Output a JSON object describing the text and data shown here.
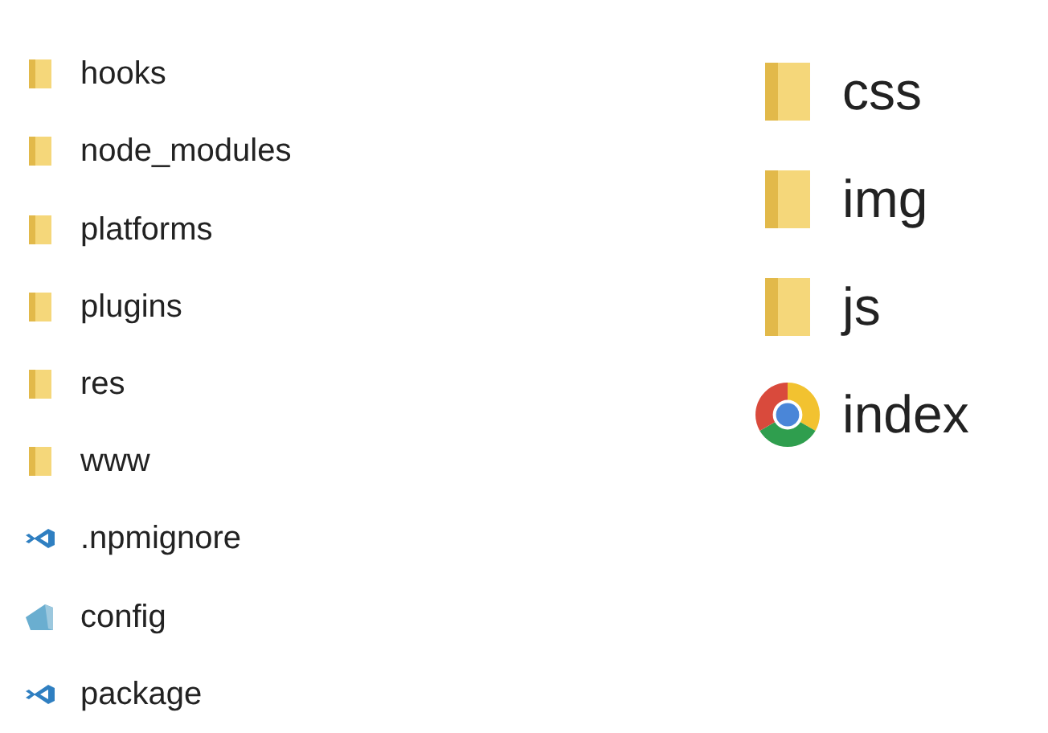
{
  "left_list": [
    {
      "name": "hooks",
      "kind": "folder"
    },
    {
      "name": "node_modules",
      "kind": "folder"
    },
    {
      "name": "platforms",
      "kind": "folder"
    },
    {
      "name": "plugins",
      "kind": "folder"
    },
    {
      "name": "res",
      "kind": "folder"
    },
    {
      "name": "www",
      "kind": "folder"
    },
    {
      "name": ".npmignore",
      "kind": "vscode"
    },
    {
      "name": "config",
      "kind": "config"
    },
    {
      "name": "package",
      "kind": "vscode"
    }
  ],
  "right_list": [
    {
      "name": "css",
      "kind": "folder"
    },
    {
      "name": "img",
      "kind": "folder"
    },
    {
      "name": "js",
      "kind": "folder"
    },
    {
      "name": "index",
      "kind": "chrome"
    }
  ]
}
